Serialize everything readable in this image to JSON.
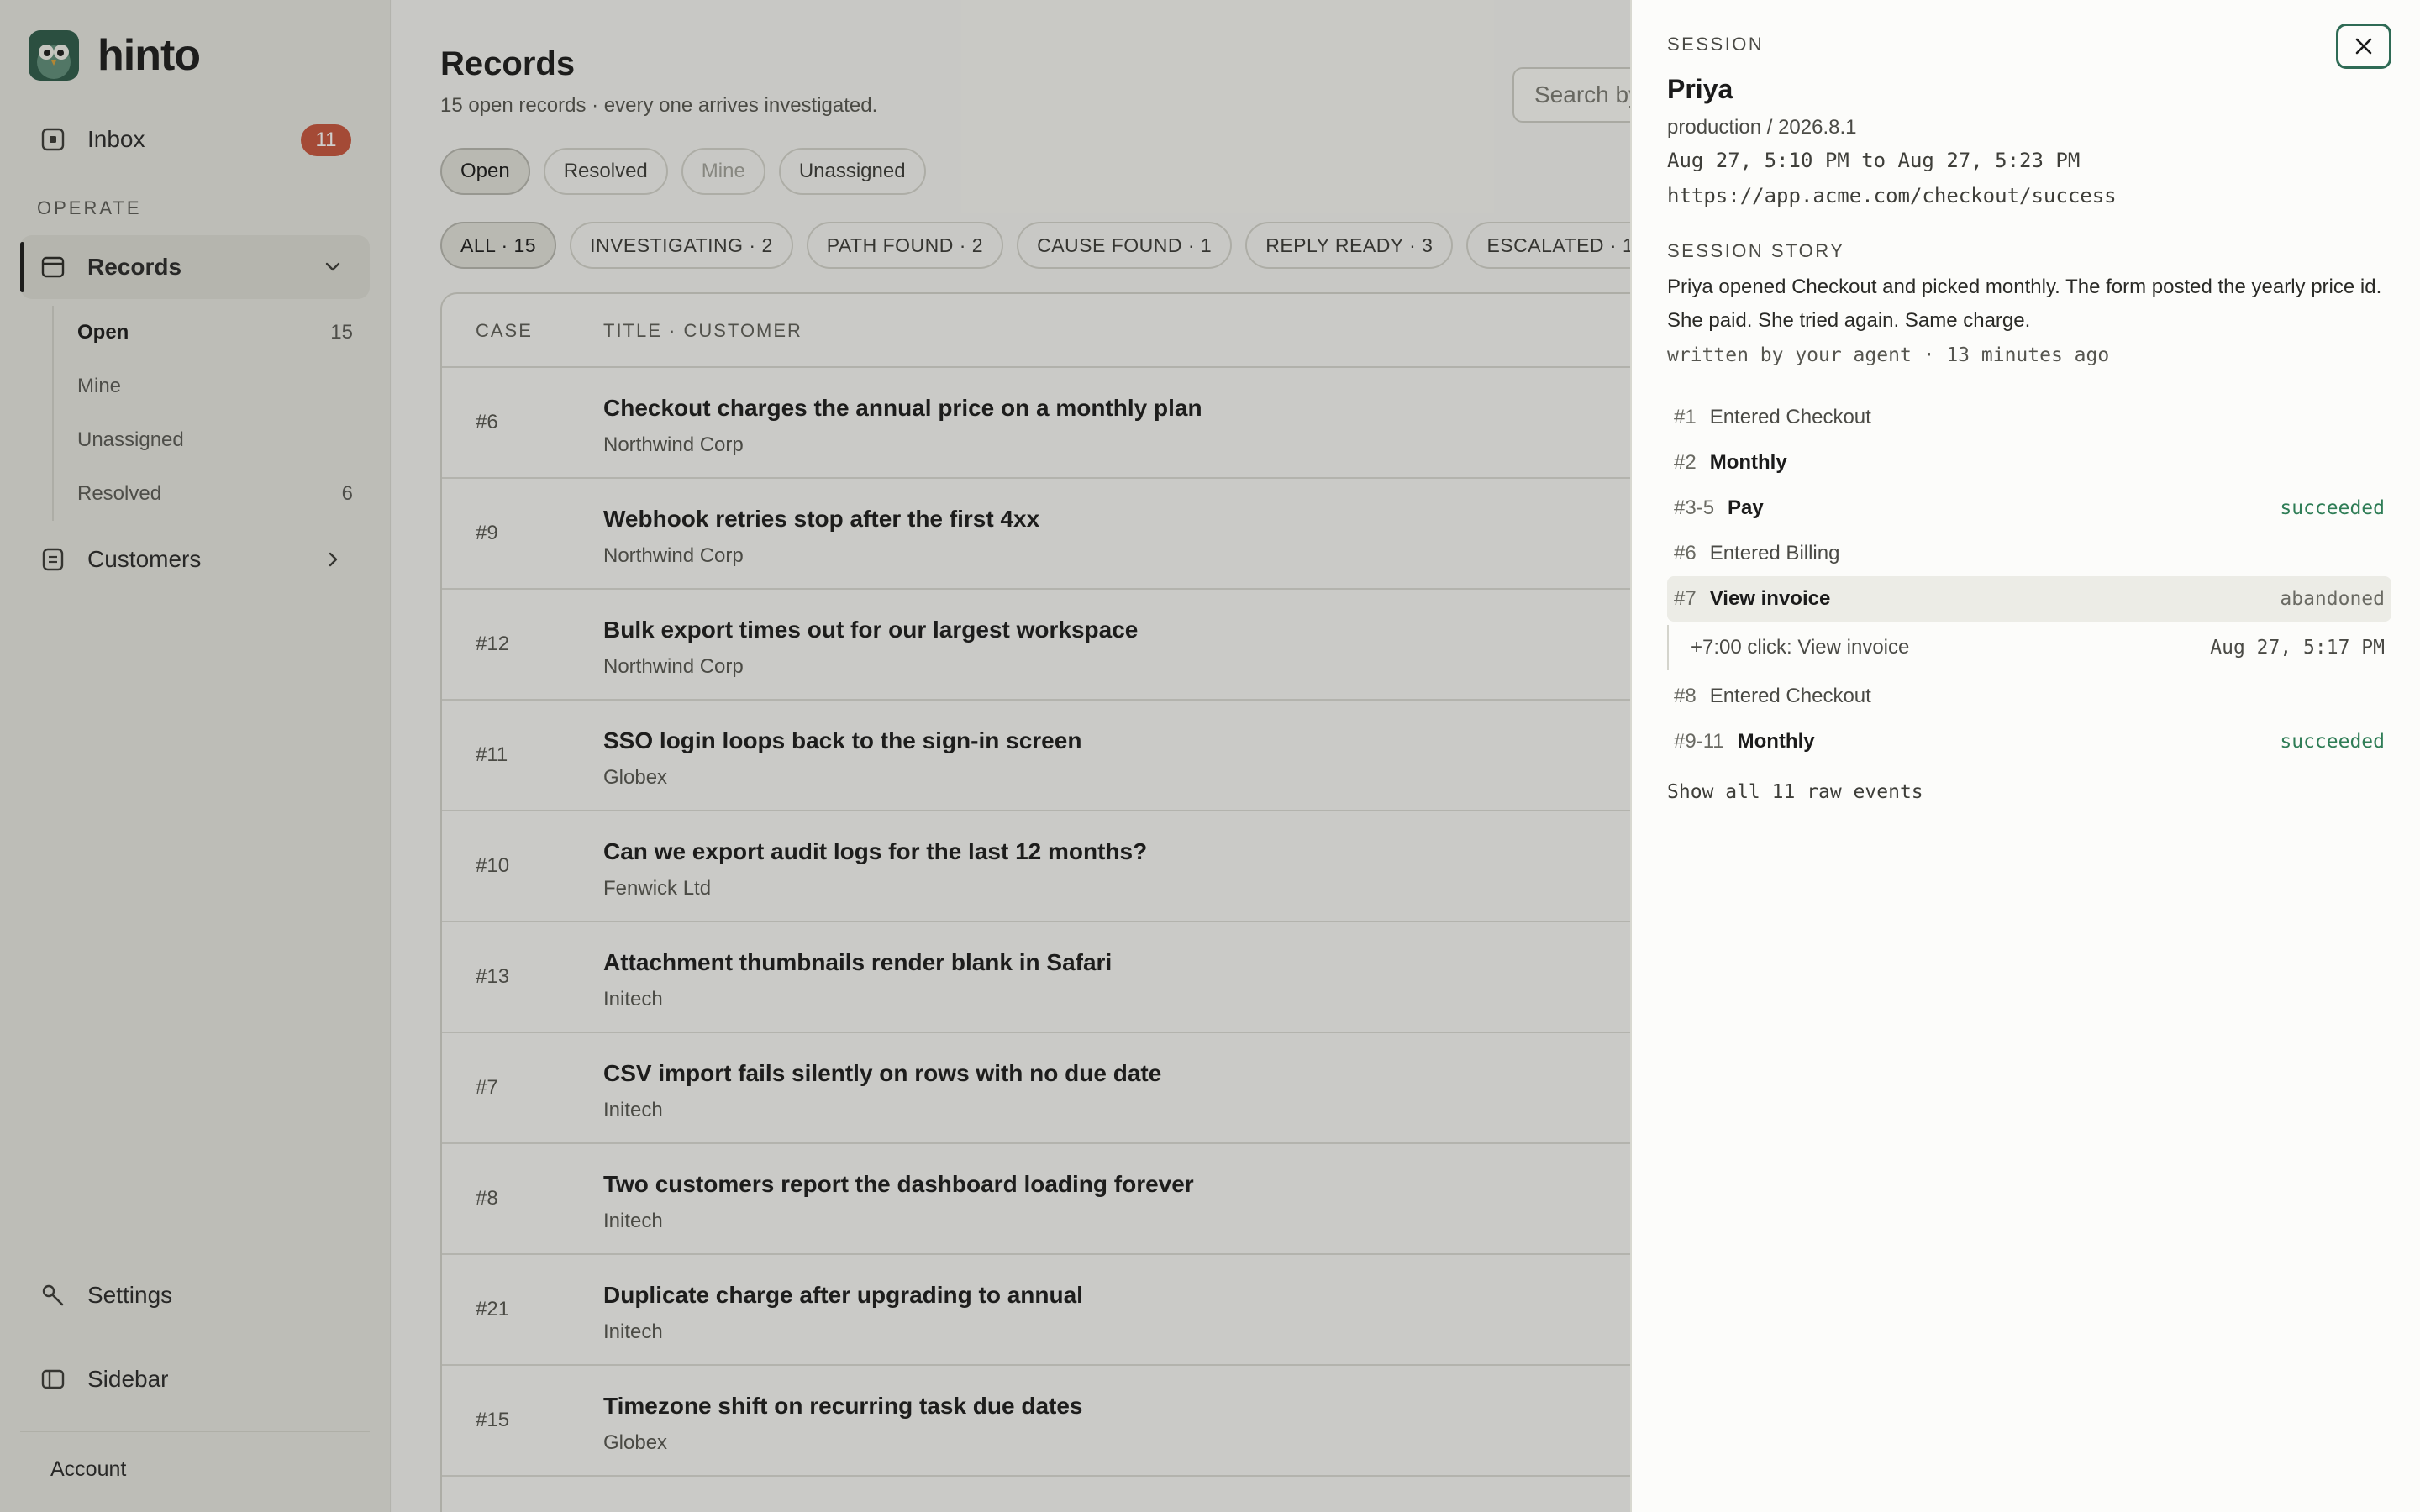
{
  "app": {
    "name": "hinto"
  },
  "sidebar": {
    "inbox": {
      "label": "Inbox",
      "badge": "11"
    },
    "section_label": "OPERATE",
    "records": {
      "label": "Records"
    },
    "subnav": [
      {
        "label": "Open",
        "count": "15"
      },
      {
        "label": "Mine",
        "count": ""
      },
      {
        "label": "Unassigned",
        "count": ""
      },
      {
        "label": "Resolved",
        "count": "6"
      }
    ],
    "customers": {
      "label": "Customers"
    },
    "settings": {
      "label": "Settings"
    },
    "sidebar_toggle": {
      "label": "Sidebar"
    },
    "account": {
      "label": "Account"
    }
  },
  "main": {
    "title": "Records",
    "subtitle": "15 open records · every one arrives investigated.",
    "search_placeholder": "Search by title, customer, case",
    "view_filters": [
      "Open",
      "Resolved",
      "Mine",
      "Unassigned"
    ],
    "status_filters": [
      "ALL · 15",
      "INVESTIGATING · 2",
      "PATH FOUND · 2",
      "CAUSE FOUND · 1",
      "REPLY READY · 3",
      "ESCALATED · 1"
    ],
    "columns": {
      "case": "CASE",
      "title": "TITLE · CUSTOMER"
    },
    "rows": [
      {
        "case": "#6",
        "title": "Checkout charges the annual price on a monthly plan",
        "customer": "Northwind Corp"
      },
      {
        "case": "#9",
        "title": "Webhook retries stop after the first 4xx",
        "customer": "Northwind Corp"
      },
      {
        "case": "#12",
        "title": "Bulk export times out for our largest workspace",
        "customer": "Northwind Corp"
      },
      {
        "case": "#11",
        "title": "SSO login loops back to the sign-in screen",
        "customer": "Globex"
      },
      {
        "case": "#10",
        "title": "Can we export audit logs for the last 12 months?",
        "customer": "Fenwick Ltd"
      },
      {
        "case": "#13",
        "title": "Attachment thumbnails render blank in Safari",
        "customer": "Initech"
      },
      {
        "case": "#7",
        "title": "CSV import fails silently on rows with no due date",
        "customer": "Initech"
      },
      {
        "case": "#8",
        "title": "Two customers report the dashboard loading forever",
        "customer": "Initech"
      },
      {
        "case": "#21",
        "title": "Duplicate charge after upgrading to annual",
        "customer": "Initech"
      },
      {
        "case": "#15",
        "title": "Timezone shift on recurring task due dates",
        "customer": "Globex"
      }
    ]
  },
  "drawer": {
    "session_label": "SESSION",
    "user": "Priya",
    "env": "production / 2026.8.1",
    "time_range": "Aug 27, 5:10 PM to Aug 27, 5:23 PM",
    "url": "https://app.acme.com/checkout/success",
    "story_label": "SESSION STORY",
    "story": "Priya opened Checkout and picked monthly. The form posted the yearly price id. She paid. She tried again. Same charge.",
    "story_meta": "written by your agent · 13 minutes ago",
    "events": [
      {
        "num": "#1",
        "label": "Entered Checkout",
        "strong": false,
        "status": ""
      },
      {
        "num": "#2",
        "label": "Monthly",
        "strong": true,
        "status": ""
      },
      {
        "num": "#3-5",
        "label": "Pay",
        "strong": true,
        "status": "succeeded"
      },
      {
        "num": "#6",
        "label": "Entered Billing",
        "strong": false,
        "status": ""
      },
      {
        "num": "#7",
        "label": "View invoice",
        "strong": true,
        "status": "abandoned"
      },
      {
        "num": "#8",
        "label": "Entered Checkout",
        "strong": false,
        "status": ""
      },
      {
        "num": "#9-11",
        "label": "Monthly",
        "strong": true,
        "status": "succeeded"
      }
    ],
    "event_detail": {
      "detail": "+7:00 click: View invoice",
      "time": "Aug 27, 5:17 PM"
    },
    "show_all": "Show all 11 raw events"
  },
  "colors": {
    "accent_green": "#2f6b55",
    "badge_red": "#c8553d",
    "success": "#2f7d56"
  },
  "icons": [
    "hinto-logo",
    "inbox-icon",
    "records-icon",
    "chevron-down-icon",
    "customers-icon",
    "chevron-right-icon",
    "settings-icon",
    "sidebar-icon",
    "close-icon"
  ]
}
